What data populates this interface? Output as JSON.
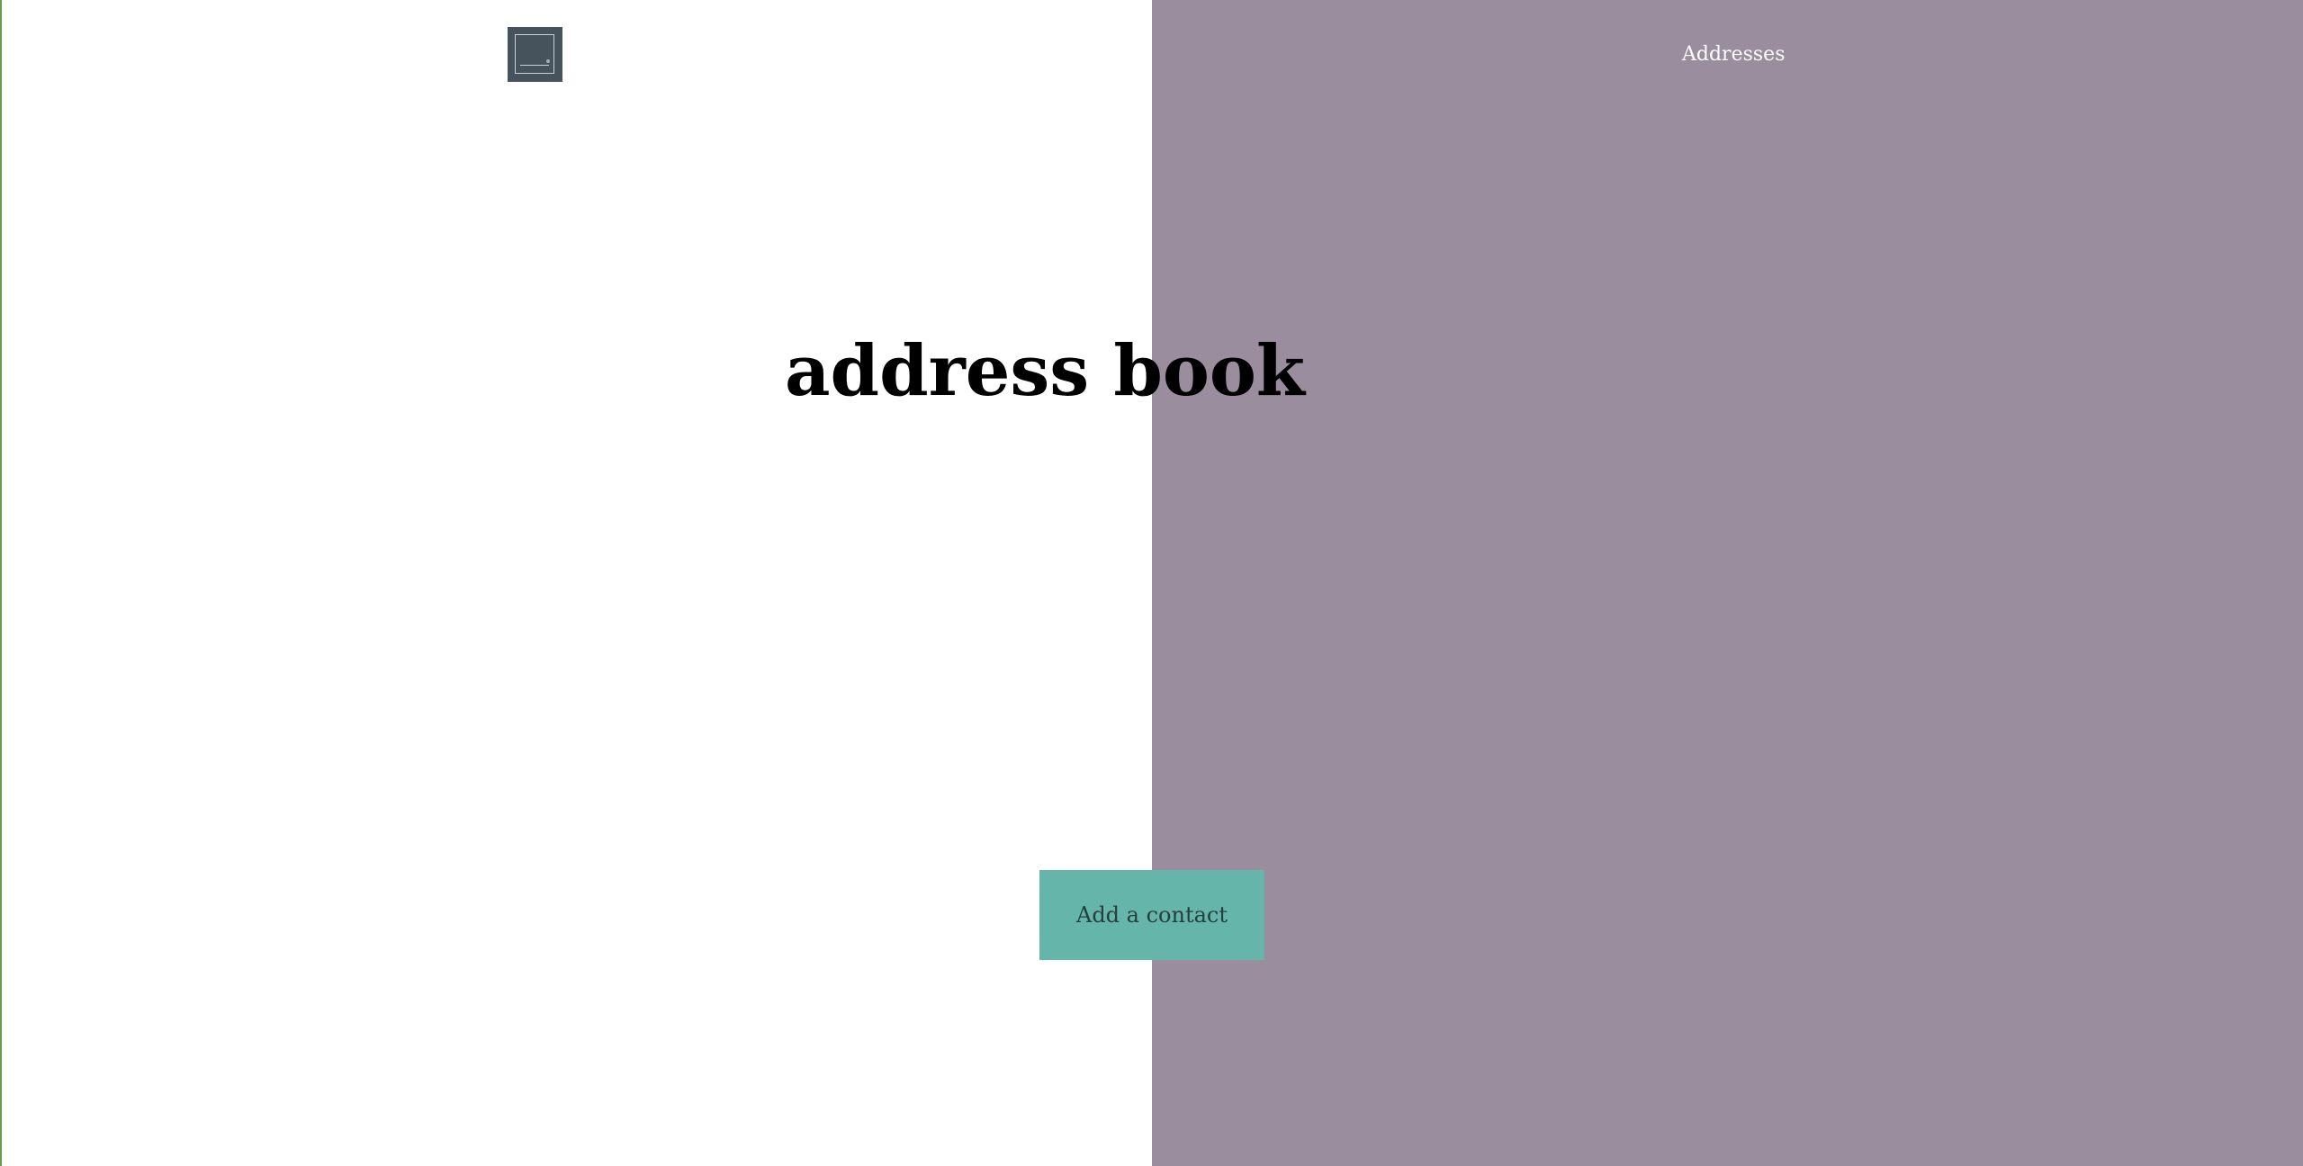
{
  "header": {
    "logo_name": "address-book-logo",
    "nav_link": "Addresses"
  },
  "main": {
    "title": "address book",
    "add_button_label": "Add a contact"
  },
  "colors": {
    "right_panel": "#9a8d9e",
    "button": "#66b5ab",
    "logo_bg": "#46525c"
  }
}
